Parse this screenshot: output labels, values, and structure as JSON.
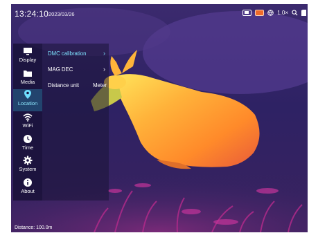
{
  "status_bar": {
    "time": "13:24:10",
    "date": "2023/03/26",
    "zoom": "1.0×",
    "icons": [
      "battery-icon",
      "record-icon",
      "wifi-globe-icon",
      "zoom-icon",
      "sd-card-icon"
    ]
  },
  "sidebar": {
    "items": [
      {
        "label": "Display",
        "icon": "display-icon",
        "active": false
      },
      {
        "label": "Media",
        "icon": "media-icon",
        "active": false
      },
      {
        "label": "Location",
        "icon": "location-pin-icon",
        "active": true
      },
      {
        "label": "WiFi",
        "icon": "wifi-icon",
        "active": false
      },
      {
        "label": "Time",
        "icon": "clock-icon",
        "active": false
      },
      {
        "label": "System",
        "icon": "gear-icon",
        "active": false
      },
      {
        "label": "About",
        "icon": "info-icon",
        "active": false
      }
    ]
  },
  "submenu": {
    "items": [
      {
        "label": "DMC calibration",
        "value": "",
        "active": true
      },
      {
        "label": "MAG DEC",
        "value": "",
        "active": false
      },
      {
        "label": "Distance unit",
        "value": "Meter",
        "active": false
      }
    ]
  },
  "footer": {
    "distance": "Distance:  100.0m"
  },
  "colors": {
    "active_text": "#7ee3ff",
    "thermal_hot": "#ffd04a",
    "thermal_mid": "#ff7a1a",
    "background_cool": "#2a1d5e"
  }
}
